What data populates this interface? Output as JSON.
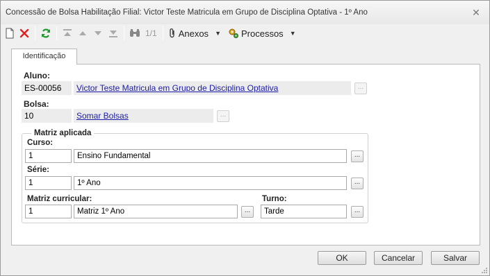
{
  "window": {
    "title": "Concessão de Bolsa Habilitação Filial: Victor Teste Matricula em Grupo de Disciplina Optativa - 1º Ano",
    "close_icon": "close-icon"
  },
  "toolbar": {
    "pager": "1/1",
    "attachments_label": "Anexos",
    "processes_label": "Processos",
    "icons": [
      "new-document-icon",
      "delete-icon",
      "refresh-icon",
      "first-record-icon",
      "previous-record-icon",
      "next-record-icon",
      "last-record-icon",
      "find-icon",
      "paperclip-icon",
      "gears-icon"
    ]
  },
  "tabs": [
    {
      "label": "Identificação",
      "active": true
    }
  ],
  "form": {
    "aluno": {
      "label": "Aluno:",
      "code": "ES-00056",
      "name": "Victor Teste Matricula em Grupo de Disciplina Optativa",
      "lookup": "..."
    },
    "bolsa": {
      "label": "Bolsa:",
      "code": "10",
      "name": "Somar Bolsas",
      "lookup": "..."
    }
  },
  "matriz": {
    "group_title": "Matriz aplicada",
    "curso": {
      "label": "Curso:",
      "code": "1",
      "name": "Ensino Fundamental",
      "lookup": "..."
    },
    "serie": {
      "label": "Série:",
      "code": "1",
      "name": "1º Ano",
      "lookup": "..."
    },
    "matriz_curricular": {
      "label": "Matriz curricular:",
      "code": "1",
      "name": "Matriz 1º Ano",
      "lookup": "..."
    },
    "turno": {
      "label": "Turno:",
      "value": "Tarde",
      "lookup": "..."
    }
  },
  "footer": {
    "ok_label": "OK",
    "cancel_label": "Cancelar",
    "save_label": "Salvar"
  },
  "colors": {
    "link": "#1a1aa6",
    "delete_icon": "#e02020",
    "refresh_icon": "#1e9a2e"
  }
}
